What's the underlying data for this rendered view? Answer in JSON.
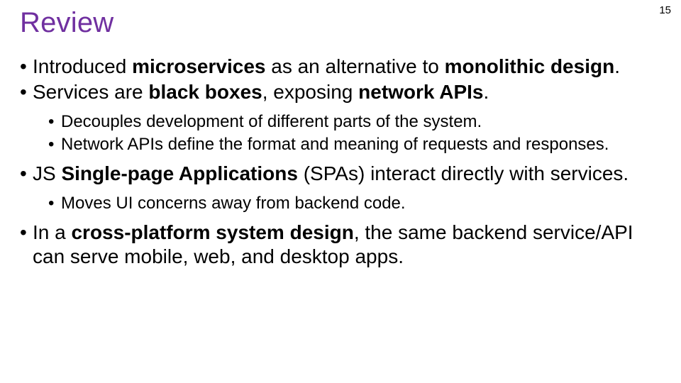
{
  "page_number": "15",
  "title": "Review",
  "bullets": {
    "b1_pre": "Introduced ",
    "b1_bold1": "microservices",
    "b1_mid": " as an alternative to ",
    "b1_bold2": "monolithic design",
    "b1_post": ".",
    "b2_pre": "Services are ",
    "b2_bold1": "black boxes",
    "b2_mid": ", exposing ",
    "b2_bold2": "network APIs",
    "b2_post": ".",
    "b2_sub1": "Decouples development of different parts of the system.",
    "b2_sub2": "Network APIs define the format and meaning of requests and responses.",
    "b3_pre": "JS ",
    "b3_bold1": "Single-page Applications",
    "b3_post": " (SPAs) interact directly with services.",
    "b3_sub1": "Moves UI concerns away from backend code.",
    "b4_pre": "In a ",
    "b4_bold1": "cross-platform system design",
    "b4_post": ", the same backend service/API can serve mobile, web, and desktop apps."
  }
}
